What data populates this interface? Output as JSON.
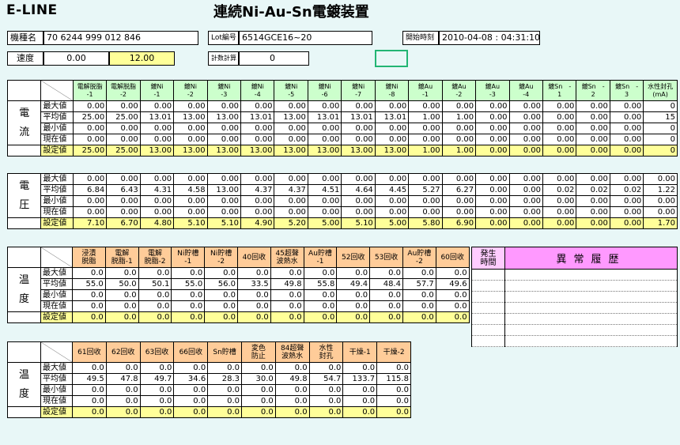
{
  "app": {
    "name": "E-LINE",
    "machine_title": "連続Ni-Au-Sn電鍍装置"
  },
  "info": {
    "model_label": "機種名",
    "model_value": "70 6244 999 012 846",
    "lot_label": "Lot編号",
    "lot_value": "6514GCE16~20",
    "start_label": "開始時刻",
    "start_value": "2010-04-08 : 04:31:10",
    "speed_label": "速度",
    "speed_value1": "0.00",
    "speed_value2": "12.00",
    "counter_label": "計数計算",
    "counter_value": "0"
  },
  "current_section": {
    "group_label": [
      "電",
      "流"
    ],
    "columns": [
      [
        "電解脱脂",
        "-1"
      ],
      [
        "電解脱脂",
        "-2"
      ],
      [
        "鍍Ni",
        "-1"
      ],
      [
        "鍍Ni",
        "-2"
      ],
      [
        "鍍Ni",
        "-3"
      ],
      [
        "鍍Ni",
        "-4"
      ],
      [
        "鍍Ni",
        "-5"
      ],
      [
        "鍍Ni",
        "-6"
      ],
      [
        "鍍Ni",
        "-7"
      ],
      [
        "鍍Ni",
        "-8"
      ],
      [
        "鍍Au",
        "-1"
      ],
      [
        "鍍Au",
        "-2"
      ],
      [
        "鍍Au",
        "-3"
      ],
      [
        "鍍Au",
        "-4"
      ],
      [
        "鍍Sn　-",
        "1"
      ],
      [
        "鍍Sn　-",
        "2"
      ],
      [
        "鍍Sn　-",
        "3"
      ],
      [
        "水性封孔",
        "(mA)"
      ]
    ],
    "rows": [
      {
        "label": "最大値",
        "values": [
          "0.00",
          "0.00",
          "0.00",
          "0.00",
          "0.00",
          "0.00",
          "0.00",
          "0.00",
          "0.00",
          "0.00",
          "0.00",
          "0.00",
          "0.00",
          "0.00",
          "0.00",
          "0.00",
          "0.00",
          "0"
        ]
      },
      {
        "label": "平均値",
        "values": [
          "25.00",
          "25.00",
          "13.01",
          "13.00",
          "13.00",
          "13.01",
          "13.00",
          "13.01",
          "13.01",
          "13.01",
          "1.00",
          "1.00",
          "0.00",
          "0.00",
          "0.00",
          "0.00",
          "0.00",
          "15"
        ]
      },
      {
        "label": "最小値",
        "values": [
          "0.00",
          "0.00",
          "0.00",
          "0.00",
          "0.00",
          "0.00",
          "0.00",
          "0.00",
          "0.00",
          "0.00",
          "0.00",
          "0.00",
          "0.00",
          "0.00",
          "0.00",
          "0.00",
          "0.00",
          "0"
        ]
      },
      {
        "label": "現在値",
        "values": [
          "0.00",
          "0.00",
          "0.00",
          "0.00",
          "0.00",
          "0.00",
          "0.00",
          "0.00",
          "0.00",
          "0.00",
          "0.00",
          "0.00",
          "0.00",
          "0.00",
          "0.00",
          "0.00",
          "0.00",
          "0"
        ]
      },
      {
        "label": "設定値",
        "values": [
          "25.00",
          "25.00",
          "13.00",
          "13.00",
          "13.00",
          "13.00",
          "13.00",
          "13.00",
          "13.00",
          "13.00",
          "1.00",
          "1.00",
          "0.00",
          "0.00",
          "0.00",
          "0.00",
          "0.00",
          "0"
        ]
      }
    ]
  },
  "voltage_section": {
    "group_label": [
      "電",
      "圧"
    ],
    "rows": [
      {
        "label": "最大値",
        "values": [
          "0.00",
          "0.00",
          "0.00",
          "0.00",
          "0.00",
          "0.00",
          "0.00",
          "0.00",
          "0.00",
          "0.00",
          "0.00",
          "0.00",
          "0.00",
          "0.00",
          "0.00",
          "0.00",
          "0.00",
          "0.00"
        ]
      },
      {
        "label": "平均値",
        "values": [
          "6.84",
          "6.43",
          "4.31",
          "4.58",
          "13.00",
          "4.37",
          "4.37",
          "4.51",
          "4.64",
          "4.45",
          "5.27",
          "6.27",
          "0.00",
          "0.00",
          "0.02",
          "0.02",
          "0.02",
          "1.22"
        ]
      },
      {
        "label": "最小値",
        "values": [
          "0.00",
          "0.00",
          "0.00",
          "0.00",
          "0.00",
          "0.00",
          "0.00",
          "0.00",
          "0.00",
          "0.00",
          "0.00",
          "0.00",
          "0.00",
          "0.00",
          "0.00",
          "0.00",
          "0.00",
          "0.00"
        ]
      },
      {
        "label": "現在値",
        "values": [
          "0.00",
          "0.00",
          "0.00",
          "0.00",
          "0.00",
          "0.00",
          "0.00",
          "0.00",
          "0.00",
          "0.00",
          "0.00",
          "0.00",
          "0.00",
          "0.00",
          "0.00",
          "0.00",
          "0.00",
          "0.00"
        ]
      },
      {
        "label": "設定値",
        "values": [
          "7.10",
          "6.70",
          "4.80",
          "5.10",
          "5.10",
          "4.90",
          "5.20",
          "5.00",
          "5.10",
          "5.00",
          "5.80",
          "6.90",
          "0.00",
          "0.00",
          "0.00",
          "0.00",
          "0.00",
          "1.70"
        ]
      }
    ]
  },
  "temp_section1": {
    "group_label": [
      "温",
      "度"
    ],
    "columns": [
      [
        "浸漬",
        "脱脂"
      ],
      [
        "電解",
        "脱脂-1"
      ],
      [
        "電解",
        "脱脂-2"
      ],
      [
        "Ni貯槽",
        "-1"
      ],
      [
        "Ni貯槽",
        "-2"
      ],
      [
        "40回收",
        ""
      ],
      [
        "45超聲",
        "波熱水"
      ],
      [
        "Au貯槽",
        "-1"
      ],
      [
        "52回收",
        ""
      ],
      [
        "53回收",
        ""
      ],
      [
        "Au貯槽",
        "-2"
      ],
      [
        "60回收",
        ""
      ]
    ],
    "rows": [
      {
        "label": "最大値",
        "values": [
          "0.0",
          "0.0",
          "0.0",
          "0.0",
          "0.0",
          "0.0",
          "0.0",
          "0.0",
          "0.0",
          "0.0",
          "0.0",
          "0.0"
        ]
      },
      {
        "label": "平均値",
        "values": [
          "55.0",
          "50.0",
          "50.1",
          "55.0",
          "56.0",
          "33.5",
          "49.8",
          "55.8",
          "49.4",
          "48.4",
          "57.7",
          "49.6"
        ]
      },
      {
        "label": "最小値",
        "values": [
          "0.0",
          "0.0",
          "0.0",
          "0.0",
          "0.0",
          "0.0",
          "0.0",
          "0.0",
          "0.0",
          "0.0",
          "0.0",
          "0.0"
        ]
      },
      {
        "label": "現在値",
        "values": [
          "0.0",
          "0.0",
          "0.0",
          "0.0",
          "0.0",
          "0.0",
          "0.0",
          "0.0",
          "0.0",
          "0.0",
          "0.0",
          "0.0"
        ]
      },
      {
        "label": "設定値",
        "values": [
          "0.0",
          "0.0",
          "0.0",
          "0.0",
          "0.0",
          "0.0",
          "0.0",
          "0.0",
          "0.0",
          "0.0",
          "0.0",
          "0.0"
        ]
      }
    ]
  },
  "temp_section2": {
    "group_label": [
      "温",
      "度"
    ],
    "columns": [
      [
        "61回收",
        ""
      ],
      [
        "62回收",
        ""
      ],
      [
        "63回收",
        ""
      ],
      [
        "66回收",
        ""
      ],
      [
        "Sn貯槽",
        ""
      ],
      [
        "変色",
        "防止"
      ],
      [
        "84超聲",
        "波熱水"
      ],
      [
        "水性",
        "封孔"
      ],
      [
        "干燥-1",
        ""
      ],
      [
        "干燥-2",
        ""
      ]
    ],
    "rows": [
      {
        "label": "最大値",
        "values": [
          "0.0",
          "0.0",
          "0.0",
          "0.0",
          "0.0",
          "0.0",
          "0.0",
          "0.0",
          "0.0",
          "0.0"
        ]
      },
      {
        "label": "平均値",
        "values": [
          "49.5",
          "47.8",
          "49.7",
          "34.6",
          "28.3",
          "30.0",
          "49.8",
          "54.7",
          "133.7",
          "115.8"
        ]
      },
      {
        "label": "最小値",
        "values": [
          "0.0",
          "0.0",
          "0.0",
          "0.0",
          "0.0",
          "0.0",
          "0.0",
          "0.0",
          "0.0",
          "0.0"
        ]
      },
      {
        "label": "現在値",
        "values": [
          "0.0",
          "0.0",
          "0.0",
          "0.0",
          "0.0",
          "0.0",
          "0.0",
          "0.0",
          "0.0",
          "0.0"
        ]
      },
      {
        "label": "設定値",
        "values": [
          "0.0",
          "0.0",
          "0.0",
          "0.0",
          "0.0",
          "0.0",
          "0.0",
          "0.0",
          "0.0",
          "0.0"
        ]
      }
    ]
  },
  "history": {
    "time_header": [
      "発生",
      "時間"
    ],
    "title": "異常履歴"
  }
}
